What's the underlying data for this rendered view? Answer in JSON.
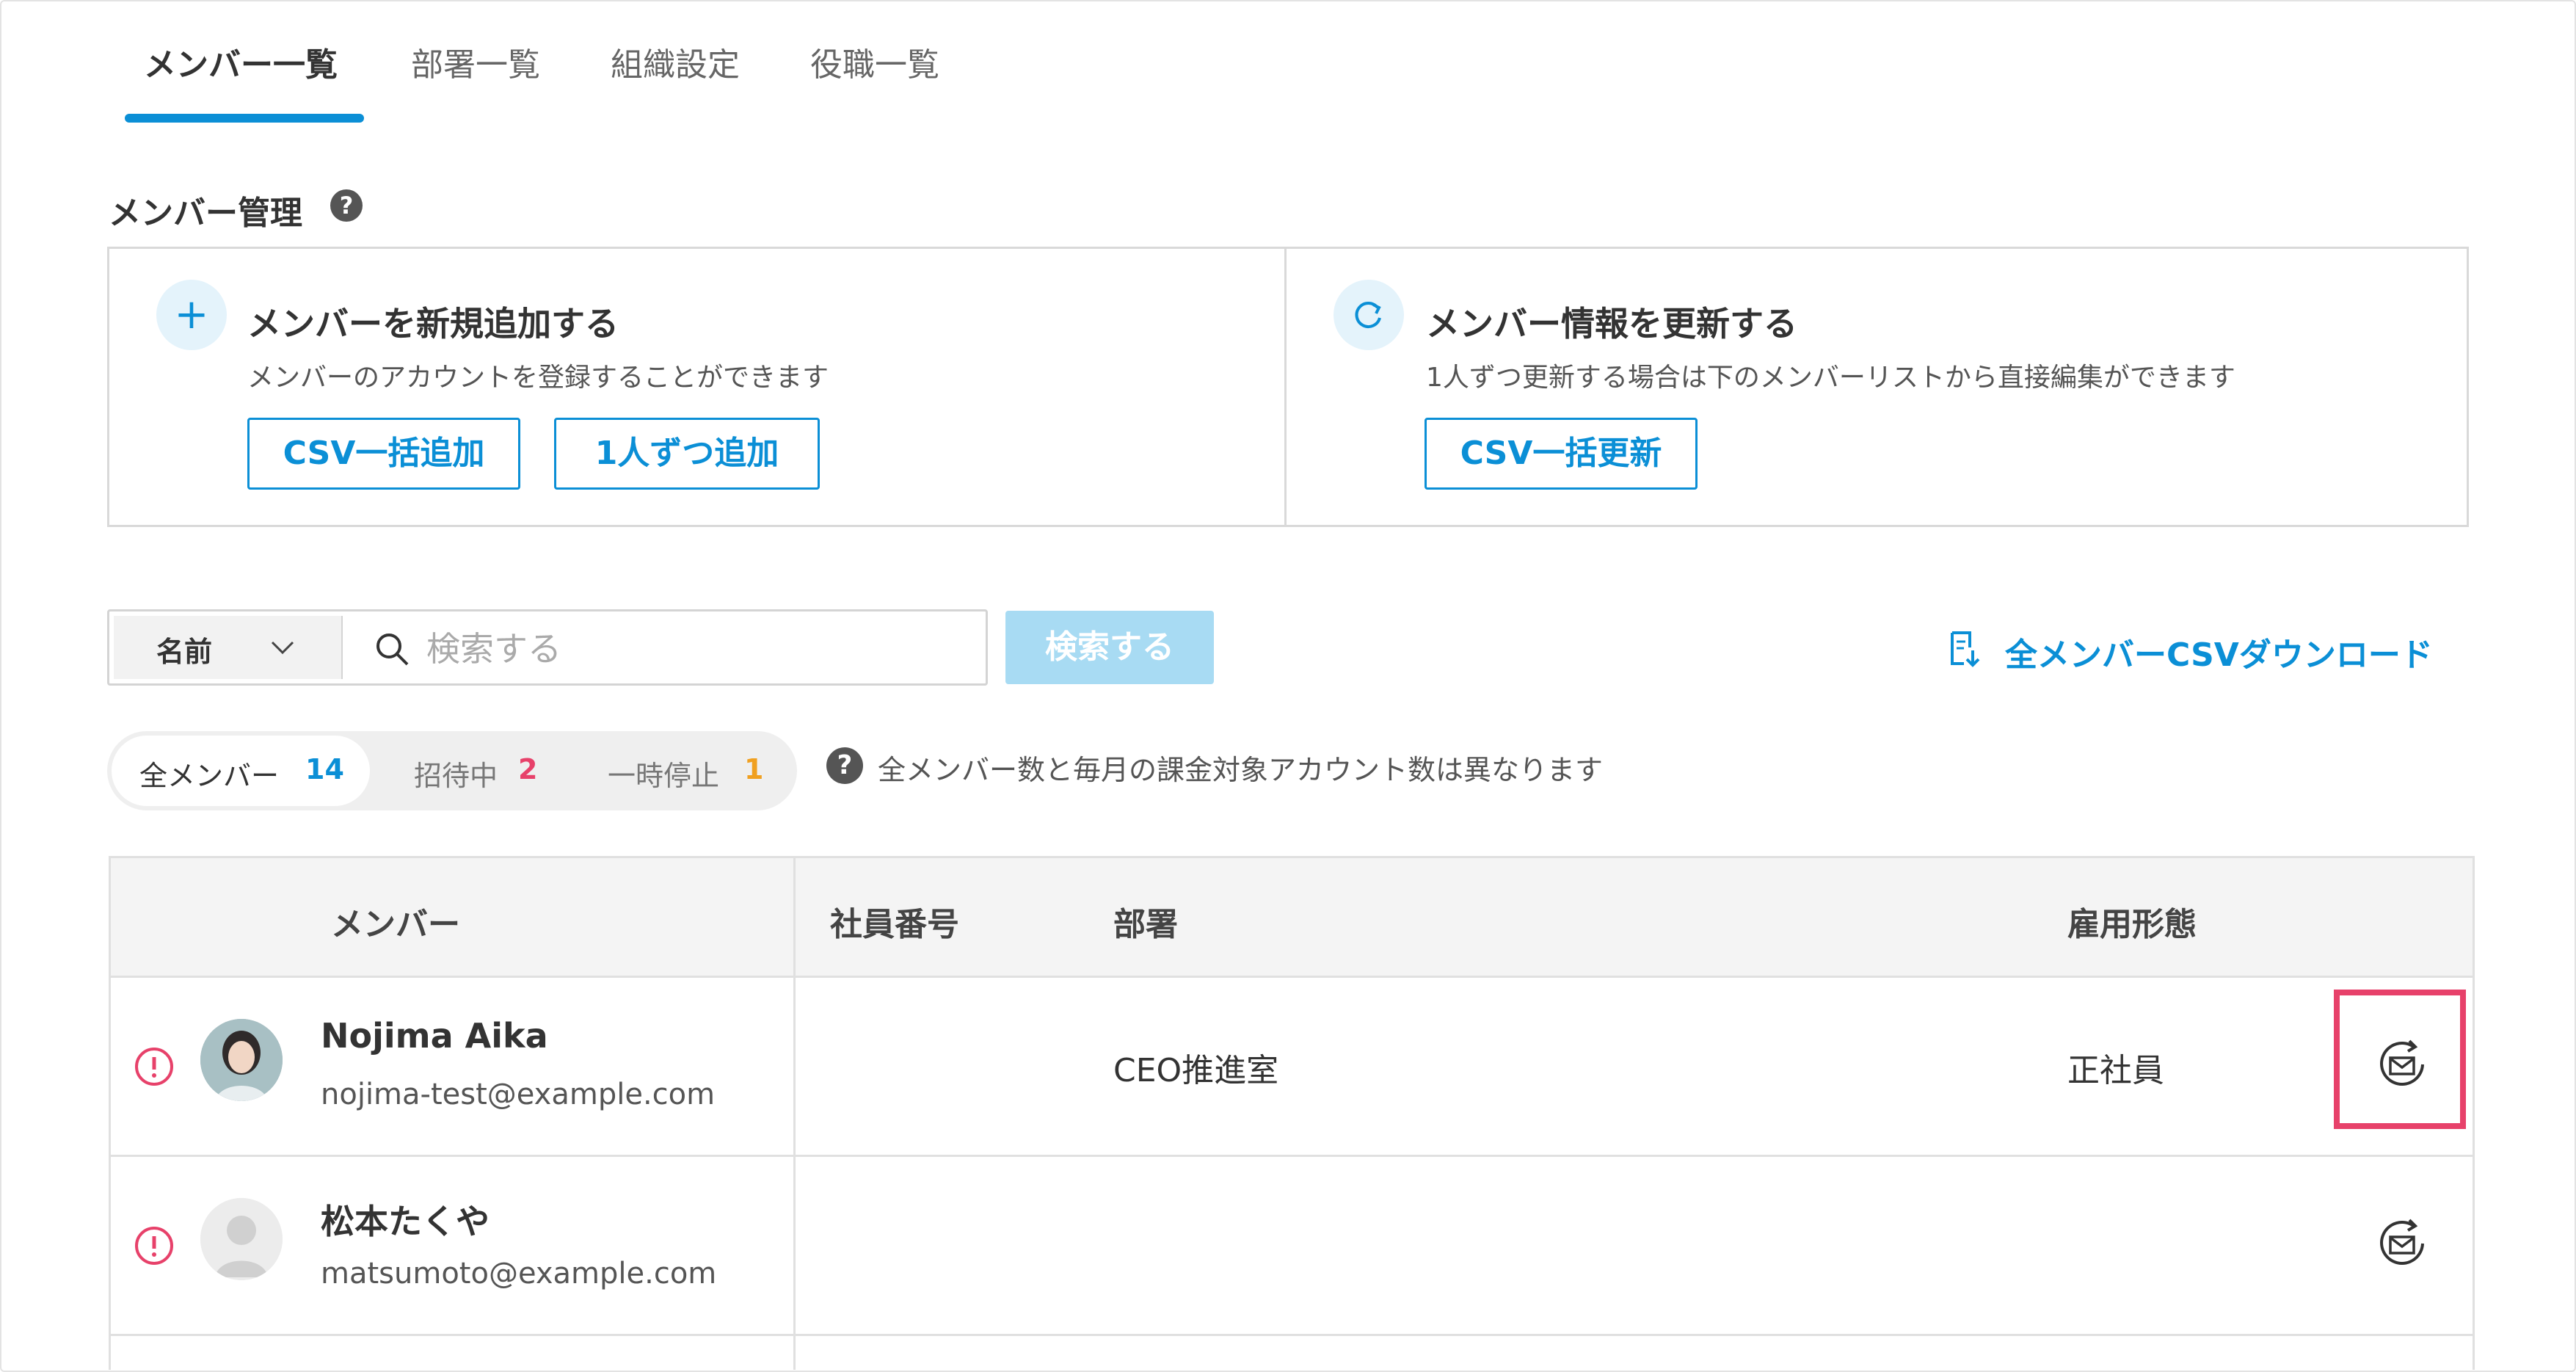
{
  "tabs": [
    {
      "label": "メンバー一覧",
      "active": true
    },
    {
      "label": "部署一覧",
      "active": false
    },
    {
      "label": "組織設定",
      "active": false
    },
    {
      "label": "役職一覧",
      "active": false
    }
  ],
  "section": {
    "title": "メンバー管理",
    "help_icon": "question-circle-icon"
  },
  "add_card": {
    "icon": "plus-icon",
    "heading": "メンバーを新規追加する",
    "description": "メンバーのアカウントを登録することができます",
    "buttons": [
      "CSV一括追加",
      "1人ずつ追加"
    ]
  },
  "update_card": {
    "icon": "refresh-icon",
    "heading": "メンバー情報を更新する",
    "description": "1人ずつ更新する場合は下のメンバーリストから直接編集ができます",
    "buttons": [
      "CSV一括更新"
    ]
  },
  "search": {
    "field_selected": "名前",
    "placeholder": "検索する",
    "button_label": "検索する"
  },
  "download": {
    "label": "全メンバーCSVダウンロード",
    "icon": "csv-download-icon"
  },
  "filters": [
    {
      "label": "全メンバー",
      "count": "14",
      "color": "#0b8fd6",
      "active": true
    },
    {
      "label": "招待中",
      "count": "2",
      "color": "#e7416a",
      "active": false
    },
    {
      "label": "一時停止",
      "count": "1",
      "color": "#f0a020",
      "active": false
    }
  ],
  "filter_note": "全メンバー数と毎月の課金対象アカウント数は異なります",
  "table": {
    "headers": [
      "メンバー",
      "社員番号",
      "部署",
      "雇用形態"
    ],
    "rows": [
      {
        "name": "Nojima Aika",
        "email": "nojima-test@example.com",
        "employee_no": "",
        "department": "CEO推進室",
        "employment_type": "正社員",
        "status_icon": "warning-circle-icon",
        "action_icon": "resend-invite-icon",
        "highlighted": true
      },
      {
        "name": "松本たくや",
        "email": "matsumoto@example.com",
        "employee_no": "",
        "department": "",
        "employment_type": "",
        "status_icon": "warning-circle-icon",
        "action_icon": "resend-invite-icon",
        "highlighted": false
      }
    ]
  },
  "colors": {
    "accent": "#0b8fd6",
    "warning": "#e7416a",
    "highlight": "#e7416a",
    "paused": "#f0a020"
  }
}
